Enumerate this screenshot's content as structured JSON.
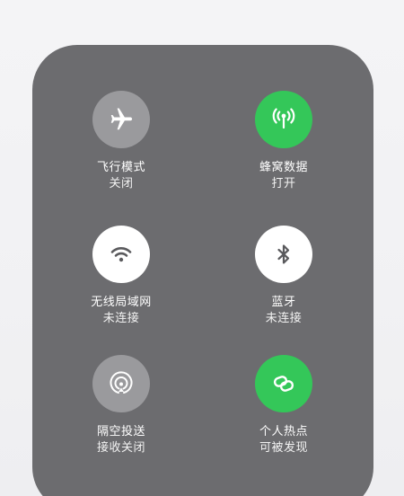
{
  "controls": [
    {
      "label": "飞行模式",
      "status": "关闭",
      "icon": "airplane-icon",
      "state": "off"
    },
    {
      "label": "蜂窝数据",
      "status": "打开",
      "icon": "antenna-icon",
      "state": "on"
    },
    {
      "label": "无线局域网",
      "status": "未连接",
      "icon": "wifi-icon",
      "state": "disconnected"
    },
    {
      "label": "蓝牙",
      "status": "未连接",
      "icon": "bluetooth-icon",
      "state": "disconnected"
    },
    {
      "label": "隔空投送",
      "status": "接收关闭",
      "icon": "airdrop-icon",
      "state": "off"
    },
    {
      "label": "个人热点",
      "status": "可被发现",
      "icon": "hotspot-link-icon",
      "state": "on"
    }
  ],
  "colors": {
    "panel": "#6c6c6f",
    "off": "#9a9a9d",
    "on": "#34c759",
    "disconnected": "#ffffff"
  }
}
